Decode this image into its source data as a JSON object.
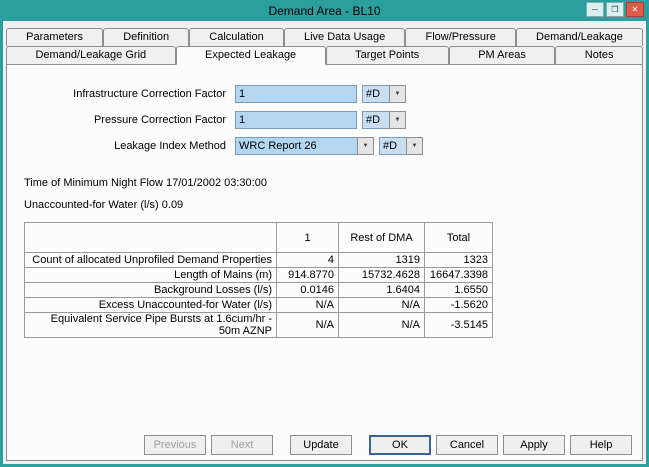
{
  "window": {
    "title": "Demand Area - BL10",
    "controls": {
      "minimize": "─",
      "maximize": "❒",
      "close": "✕"
    }
  },
  "icons": {
    "dropdown_arrow": "▼"
  },
  "tabs": {
    "row1": [
      "Parameters",
      "Definition",
      "Calculation",
      "Live Data Usage",
      "Flow/Pressure",
      "Demand/Leakage"
    ],
    "row2": [
      "Demand/Leakage Grid",
      "Expected Leakage",
      "Target Points",
      "PM Areas",
      "Notes"
    ],
    "active_tab": "Expected Leakage"
  },
  "form": {
    "fields": [
      {
        "label": "Infrastructure Correction Factor",
        "value": "1",
        "flag": "#D"
      },
      {
        "label": "Pressure Correction Factor",
        "value": "1",
        "flag": "#D"
      },
      {
        "label": "Leakage Index Method",
        "value": "WRC Report 26",
        "flag": "#D"
      }
    ]
  },
  "info": {
    "night_flow_label": "Time of Minimum Night Flow",
    "night_flow_value": "17/01/2002 03:30:00",
    "unaccounted_label": "Unaccounted-for Water (l/s)",
    "unaccounted_value": "0.09"
  },
  "results_table": {
    "headers": [
      "",
      "1",
      "Rest of DMA",
      "Total"
    ],
    "rows": [
      {
        "label": "Count of allocated Unprofiled Demand Properties",
        "values": [
          "4",
          "1319",
          "1323"
        ]
      },
      {
        "label": "Length of Mains (m)",
        "values": [
          "914.8770",
          "15732.4628",
          "16647.3398"
        ]
      },
      {
        "label": "Background Losses (l/s)",
        "values": [
          "0.0146",
          "1.6404",
          "1.6550"
        ]
      },
      {
        "label": "Excess Unaccounted-for Water (l/s)",
        "values": [
          "N/A",
          "N/A",
          "-1.5620"
        ]
      },
      {
        "label": "Equivalent Service Pipe Bursts at 1.6cum/hr - 50m AZNP",
        "values": [
          "N/A",
          "N/A",
          "-3.5145"
        ]
      }
    ]
  },
  "buttons": {
    "previous": "Previous",
    "next": "Next",
    "update": "Update",
    "ok": "OK",
    "cancel": "Cancel",
    "apply": "Apply",
    "help": "Help"
  }
}
